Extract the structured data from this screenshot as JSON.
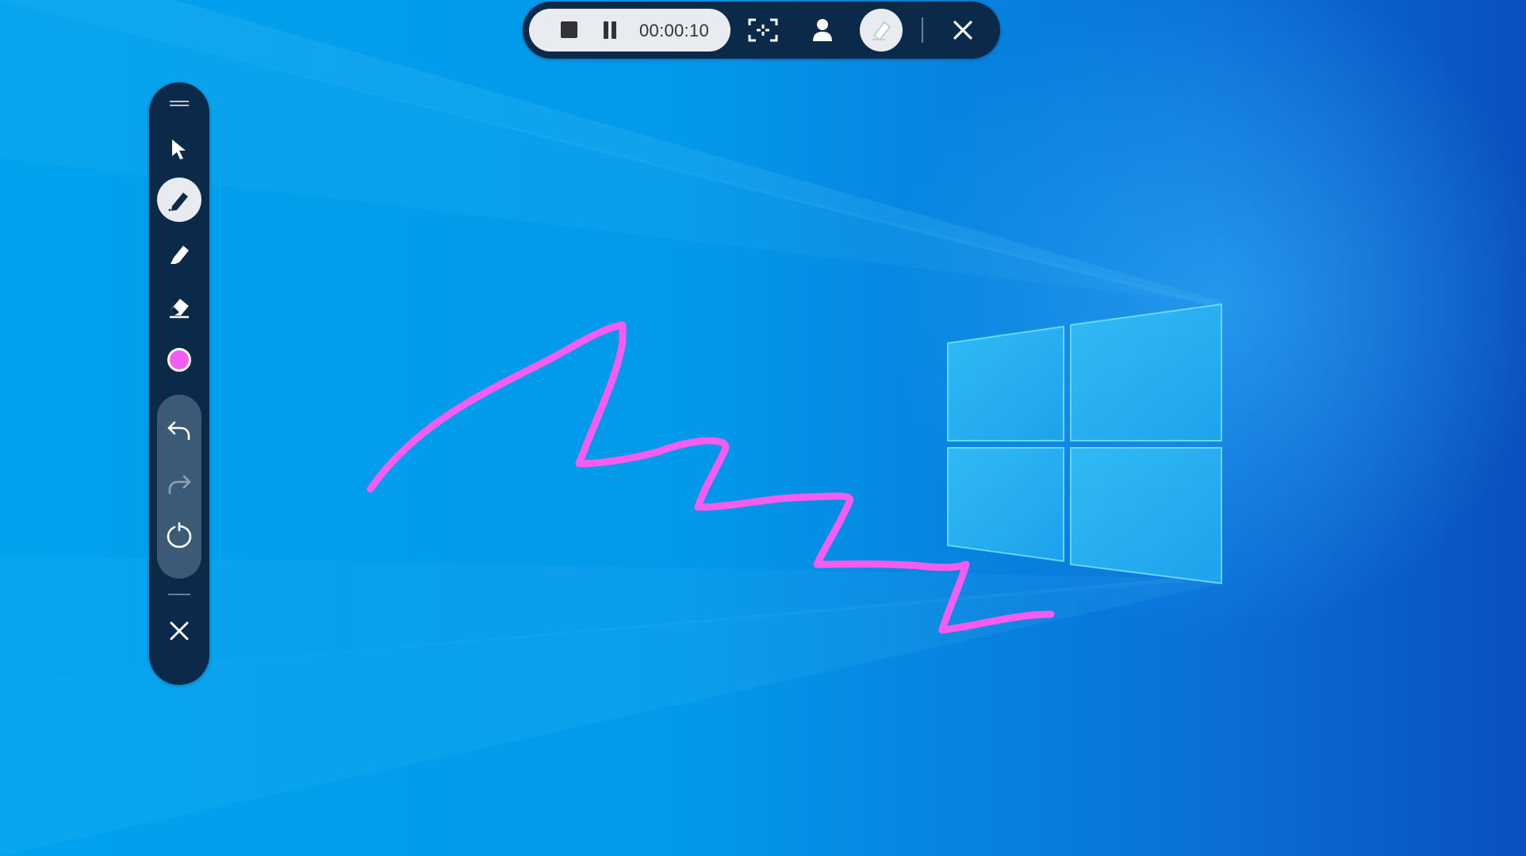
{
  "recording_bar": {
    "elapsed_time": "00:00:10",
    "stop_icon": "stop-icon",
    "pause_icon": "pause-icon",
    "region_select_icon": "region-select-icon",
    "webcam_icon": "person-icon",
    "highlight_icon": "eraser-icon",
    "close_icon": "close-icon"
  },
  "side_toolbar": {
    "tools": [
      {
        "id": "select",
        "icon": "cursor-arrow-icon",
        "active": false
      },
      {
        "id": "pen",
        "icon": "pen-icon",
        "active": true
      },
      {
        "id": "highlighter",
        "icon": "highlighter-icon",
        "active": false
      },
      {
        "id": "eraser",
        "icon": "eraser-icon",
        "active": false
      },
      {
        "id": "color",
        "icon": "color-swatch",
        "active": false
      }
    ],
    "history": [
      {
        "id": "undo",
        "icon": "undo-icon",
        "enabled": true
      },
      {
        "id": "redo",
        "icon": "redo-icon",
        "enabled": false
      },
      {
        "id": "clear",
        "icon": "reset-icon",
        "enabled": true
      }
    ],
    "close_icon": "close-icon"
  },
  "colors": {
    "toolbar_bg": "#0b2a4a",
    "active_tool_bg": "#e8ecf0",
    "pen_color": "#f55df0",
    "desktop_blue": "#0399ea"
  }
}
